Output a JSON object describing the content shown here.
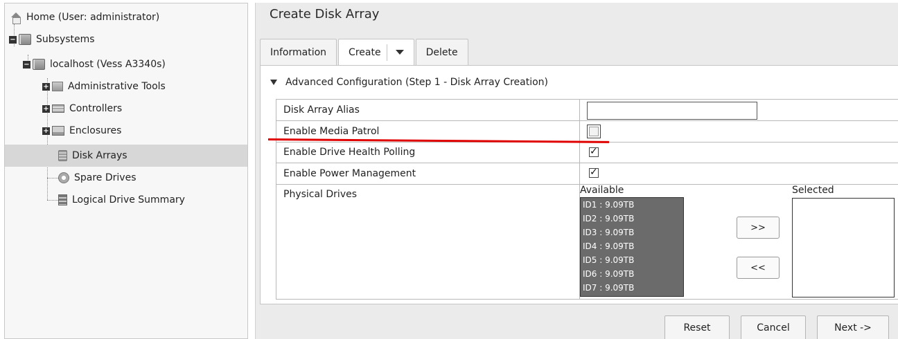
{
  "tree": {
    "home": "Home (User: administrator)",
    "subsystems": "Subsystems",
    "localhost": "localhost (Vess A3340s)",
    "admin_tools": "Administrative Tools",
    "controllers": "Controllers",
    "enclosures": "Enclosures",
    "disk_arrays": "Disk Arrays",
    "spare_drives": "Spare Drives",
    "logical_summary": "Logical Drive Summary",
    "selected": "Disk Arrays"
  },
  "main": {
    "title": "Create Disk Array",
    "tabs": [
      {
        "label": "Information"
      },
      {
        "label": "Create"
      },
      {
        "label": "Delete"
      }
    ],
    "active_tab": "Create",
    "section_title": "Advanced Configuration (Step 1 - Disk Array Creation)",
    "fields": {
      "alias_label": "Disk Array Alias",
      "alias_value": "",
      "media_patrol_label": "Enable Media Patrol",
      "media_patrol_checked": false,
      "health_polling_label": "Enable Drive Health Polling",
      "health_polling_checked": true,
      "power_mgmt_label": "Enable Power Management",
      "power_mgmt_checked": true,
      "physical_drives_label": "Physical Drives"
    },
    "drives": {
      "available_label": "Available",
      "selected_label": "Selected",
      "available": [
        "ID1 : 9.09TB",
        "ID2 : 9.09TB",
        "ID3 : 9.09TB",
        "ID4 : 9.09TB",
        "ID5 : 9.09TB",
        "ID6 : 9.09TB",
        "ID7 : 9.09TB"
      ],
      "selected": [],
      "add_label": ">>",
      "remove_label": "<<"
    },
    "buttons": {
      "reset": "Reset",
      "cancel": "Cancel",
      "next": "Next ->"
    }
  },
  "colors": {
    "annotation_line": "#e00000",
    "selected_tree_bg": "#d7d7d7",
    "available_list_bg": "#6b6b6b"
  }
}
